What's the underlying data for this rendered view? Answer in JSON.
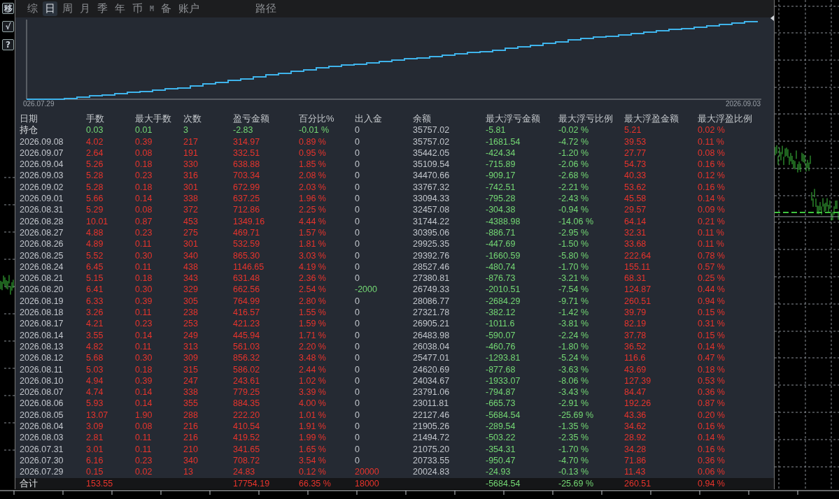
{
  "side_buttons": [
    "移",
    "√",
    "?"
  ],
  "tabs": [
    {
      "label": "综",
      "kind": "text",
      "selected": false
    },
    {
      "label": "日",
      "kind": "text",
      "selected": true
    },
    {
      "label": "周",
      "kind": "text",
      "selected": false
    },
    {
      "label": "月",
      "kind": "text",
      "selected": false
    },
    {
      "label": "季",
      "kind": "text",
      "selected": false
    },
    {
      "label": "年",
      "kind": "text",
      "selected": false
    },
    {
      "label": "币",
      "kind": "text",
      "selected": false
    },
    {
      "label": "M",
      "kind": "mono",
      "selected": false
    },
    {
      "label": "备",
      "kind": "text",
      "selected": false
    },
    {
      "label": "账户",
      "kind": "text",
      "selected": false
    }
  ],
  "path_button": "路径",
  "equity_chart": {
    "start_label": "026.07.29",
    "end_label": "2026.09.03"
  },
  "table": {
    "columns": [
      "日期",
      "手数",
      "最大手数",
      "次数",
      "盈亏金额",
      "百分比%",
      "出入金",
      "余额",
      "最大浮亏金额",
      "最大浮亏比例",
      "最大浮盈金额",
      "最大浮盈比例"
    ],
    "rows": [
      {
        "kind": "position",
        "color": "#74d874",
        "date": "持仓",
        "lots": "0.03",
        "max_lots": "0.01",
        "trades": "3",
        "pnl": "-2.83",
        "pct": "-0.01 %",
        "flow": {
          "text": "0",
          "color": "#c2c6cc"
        },
        "balance": "35757.02",
        "max_float_loss": "-5.81",
        "max_float_loss_pct": "-0.02 %",
        "max_float_profit": "5.21",
        "max_float_profit_pct": "0.02 %"
      },
      {
        "kind": "day",
        "color": "#e8342c",
        "date": "2026.09.08",
        "lots": "4.02",
        "max_lots": "0.39",
        "trades": "217",
        "pnl": "314.97",
        "pct": "0.89 %",
        "flow": {
          "text": "0",
          "color": "#c2c6cc"
        },
        "balance": "35757.02",
        "max_float_loss": "-1681.54",
        "max_float_loss_pct": "-4.72 %",
        "max_float_profit": "39.53",
        "max_float_profit_pct": "0.11 %"
      },
      {
        "kind": "day",
        "color": "#e8342c",
        "date": "2026.09.07",
        "lots": "2.64",
        "max_lots": "0.08",
        "trades": "191",
        "pnl": "332.51",
        "pct": "0.95 %",
        "flow": {
          "text": "0",
          "color": "#c2c6cc"
        },
        "balance": "35442.05",
        "max_float_loss": "-424.34",
        "max_float_loss_pct": "-1.20 %",
        "max_float_profit": "27.77",
        "max_float_profit_pct": "0.08 %"
      },
      {
        "kind": "day",
        "color": "#e8342c",
        "date": "2026.09.04",
        "lots": "5.26",
        "max_lots": "0.18",
        "trades": "330",
        "pnl": "638.88",
        "pct": "1.85 %",
        "flow": {
          "text": "0",
          "color": "#c2c6cc"
        },
        "balance": "35109.54",
        "max_float_loss": "-715.89",
        "max_float_loss_pct": "-2.06 %",
        "max_float_profit": "54.73",
        "max_float_profit_pct": "0.16 %"
      },
      {
        "kind": "day",
        "color": "#e8342c",
        "date": "2026.09.03",
        "lots": "5.28",
        "max_lots": "0.23",
        "trades": "316",
        "pnl": "703.34",
        "pct": "2.08 %",
        "flow": {
          "text": "0",
          "color": "#c2c6cc"
        },
        "balance": "34470.66",
        "max_float_loss": "-909.17",
        "max_float_loss_pct": "-2.68 %",
        "max_float_profit": "40.33",
        "max_float_profit_pct": "0.12 %"
      },
      {
        "kind": "day",
        "color": "#e8342c",
        "date": "2026.09.02",
        "lots": "5.28",
        "max_lots": "0.18",
        "trades": "301",
        "pnl": "672.99",
        "pct": "2.03 %",
        "flow": {
          "text": "0",
          "color": "#c2c6cc"
        },
        "balance": "33767.32",
        "max_float_loss": "-742.51",
        "max_float_loss_pct": "-2.21 %",
        "max_float_profit": "53.62",
        "max_float_profit_pct": "0.16 %"
      },
      {
        "kind": "day",
        "color": "#e8342c",
        "date": "2026.09.01",
        "lots": "5.66",
        "max_lots": "0.14",
        "trades": "338",
        "pnl": "637.25",
        "pct": "1.96 %",
        "flow": {
          "text": "0",
          "color": "#c2c6cc"
        },
        "balance": "33094.33",
        "max_float_loss": "-795.28",
        "max_float_loss_pct": "-2.43 %",
        "max_float_profit": "45.58",
        "max_float_profit_pct": "0.14 %"
      },
      {
        "kind": "day",
        "color": "#e8342c",
        "date": "2026.08.31",
        "lots": "5.29",
        "max_lots": "0.08",
        "trades": "372",
        "pnl": "712.86",
        "pct": "2.25 %",
        "flow": {
          "text": "0",
          "color": "#c2c6cc"
        },
        "balance": "32457.08",
        "max_float_loss": "-304.38",
        "max_float_loss_pct": "-0.94 %",
        "max_float_profit": "29.57",
        "max_float_profit_pct": "0.09 %"
      },
      {
        "kind": "day",
        "color": "#e8342c",
        "date": "2026.08.28",
        "lots": "10.01",
        "max_lots": "0.87",
        "trades": "453",
        "pnl": "1349.16",
        "pct": "4.44 %",
        "flow": {
          "text": "0",
          "color": "#c2c6cc"
        },
        "balance": "31744.22",
        "max_float_loss": "-4388.98",
        "max_float_loss_pct": "-14.06 %",
        "max_float_profit": "64.14",
        "max_float_profit_pct": "0.21 %"
      },
      {
        "kind": "day",
        "color": "#e8342c",
        "date": "2026.08.27",
        "lots": "4.88",
        "max_lots": "0.23",
        "trades": "275",
        "pnl": "469.71",
        "pct": "1.57 %",
        "flow": {
          "text": "0",
          "color": "#c2c6cc"
        },
        "balance": "30395.06",
        "max_float_loss": "-886.71",
        "max_float_loss_pct": "-2.95 %",
        "max_float_profit": "32.31",
        "max_float_profit_pct": "0.11 %"
      },
      {
        "kind": "day",
        "color": "#e8342c",
        "date": "2026.08.26",
        "lots": "4.89",
        "max_lots": "0.11",
        "trades": "301",
        "pnl": "532.59",
        "pct": "1.81 %",
        "flow": {
          "text": "0",
          "color": "#c2c6cc"
        },
        "balance": "29925.35",
        "max_float_loss": "-447.69",
        "max_float_loss_pct": "-1.50 %",
        "max_float_profit": "33.68",
        "max_float_profit_pct": "0.11 %"
      },
      {
        "kind": "day",
        "color": "#e8342c",
        "date": "2026.08.25",
        "lots": "5.52",
        "max_lots": "0.30",
        "trades": "340",
        "pnl": "865.30",
        "pct": "3.03 %",
        "flow": {
          "text": "0",
          "color": "#c2c6cc"
        },
        "balance": "29392.76",
        "max_float_loss": "-1660.59",
        "max_float_loss_pct": "-5.80 %",
        "max_float_profit": "222.64",
        "max_float_profit_pct": "0.78 %"
      },
      {
        "kind": "day",
        "color": "#e8342c",
        "date": "2026.08.24",
        "lots": "6.45",
        "max_lots": "0.11",
        "trades": "438",
        "pnl": "1146.65",
        "pct": "4.19 %",
        "flow": {
          "text": "0",
          "color": "#c2c6cc"
        },
        "balance": "28527.46",
        "max_float_loss": "-480.74",
        "max_float_loss_pct": "-1.70 %",
        "max_float_profit": "155.11",
        "max_float_profit_pct": "0.57 %"
      },
      {
        "kind": "day",
        "color": "#e8342c",
        "date": "2026.08.21",
        "lots": "5.15",
        "max_lots": "0.18",
        "trades": "343",
        "pnl": "631.48",
        "pct": "2.36 %",
        "flow": {
          "text": "0",
          "color": "#c2c6cc"
        },
        "balance": "27380.81",
        "max_float_loss": "-876.73",
        "max_float_loss_pct": "-3.21 %",
        "max_float_profit": "68.31",
        "max_float_profit_pct": "0.25 %"
      },
      {
        "kind": "day",
        "color": "#e8342c",
        "date": "2026.08.20",
        "lots": "6.41",
        "max_lots": "0.30",
        "trades": "329",
        "pnl": "662.56",
        "pct": "2.54 %",
        "flow": {
          "text": "-2000",
          "color": "#74d874"
        },
        "balance": "26749.33",
        "max_float_loss": "-2010.51",
        "max_float_loss_pct": "-7.54 %",
        "max_float_profit": "124.87",
        "max_float_profit_pct": "0.44 %"
      },
      {
        "kind": "day",
        "color": "#e8342c",
        "date": "2026.08.19",
        "lots": "6.33",
        "max_lots": "0.39",
        "trades": "305",
        "pnl": "764.99",
        "pct": "2.80 %",
        "flow": {
          "text": "0",
          "color": "#c2c6cc"
        },
        "balance": "28086.77",
        "max_float_loss": "-2684.29",
        "max_float_loss_pct": "-9.71 %",
        "max_float_profit": "260.51",
        "max_float_profit_pct": "0.94 %"
      },
      {
        "kind": "day",
        "color": "#e8342c",
        "date": "2026.08.18",
        "lots": "3.26",
        "max_lots": "0.11",
        "trades": "238",
        "pnl": "416.57",
        "pct": "1.55 %",
        "flow": {
          "text": "0",
          "color": "#c2c6cc"
        },
        "balance": "27321.78",
        "max_float_loss": "-382.12",
        "max_float_loss_pct": "-1.42 %",
        "max_float_profit": "39.79",
        "max_float_profit_pct": "0.15 %"
      },
      {
        "kind": "day",
        "color": "#e8342c",
        "date": "2026.08.17",
        "lots": "4.21",
        "max_lots": "0.23",
        "trades": "253",
        "pnl": "421.23",
        "pct": "1.59 %",
        "flow": {
          "text": "0",
          "color": "#c2c6cc"
        },
        "balance": "26905.21",
        "max_float_loss": "-1011.6",
        "max_float_loss_pct": "-3.81 %",
        "max_float_profit": "82.19",
        "max_float_profit_pct": "0.31 %"
      },
      {
        "kind": "day",
        "color": "#e8342c",
        "date": "2026.08.14",
        "lots": "3.55",
        "max_lots": "0.14",
        "trades": "249",
        "pnl": "445.94",
        "pct": "1.71 %",
        "flow": {
          "text": "0",
          "color": "#c2c6cc"
        },
        "balance": "26483.98",
        "max_float_loss": "-590.07",
        "max_float_loss_pct": "-2.24 %",
        "max_float_profit": "37.78",
        "max_float_profit_pct": "0.15 %"
      },
      {
        "kind": "day",
        "color": "#e8342c",
        "date": "2026.08.13",
        "lots": "4.82",
        "max_lots": "0.11",
        "trades": "313",
        "pnl": "561.03",
        "pct": "2.20 %",
        "flow": {
          "text": "0",
          "color": "#c2c6cc"
        },
        "balance": "26038.04",
        "max_float_loss": "-460.76",
        "max_float_loss_pct": "-1.80 %",
        "max_float_profit": "36.52",
        "max_float_profit_pct": "0.14 %"
      },
      {
        "kind": "day",
        "color": "#e8342c",
        "date": "2026.08.12",
        "lots": "5.68",
        "max_lots": "0.30",
        "trades": "309",
        "pnl": "856.32",
        "pct": "3.48 %",
        "flow": {
          "text": "0",
          "color": "#c2c6cc"
        },
        "balance": "25477.01",
        "max_float_loss": "-1293.81",
        "max_float_loss_pct": "-5.24 %",
        "max_float_profit": "116.6",
        "max_float_profit_pct": "0.47 %"
      },
      {
        "kind": "day",
        "color": "#e8342c",
        "date": "2026.08.11",
        "lots": "5.03",
        "max_lots": "0.18",
        "trades": "315",
        "pnl": "586.02",
        "pct": "2.44 %",
        "flow": {
          "text": "0",
          "color": "#c2c6cc"
        },
        "balance": "24620.69",
        "max_float_loss": "-877.68",
        "max_float_loss_pct": "-3.63 %",
        "max_float_profit": "43.69",
        "max_float_profit_pct": "0.18 %"
      },
      {
        "kind": "day",
        "color": "#e8342c",
        "date": "2026.08.10",
        "lots": "4.94",
        "max_lots": "0.39",
        "trades": "247",
        "pnl": "243.61",
        "pct": "1.02 %",
        "flow": {
          "text": "0",
          "color": "#c2c6cc"
        },
        "balance": "24034.67",
        "max_float_loss": "-1933.07",
        "max_float_loss_pct": "-8.06 %",
        "max_float_profit": "127.39",
        "max_float_profit_pct": "0.53 %"
      },
      {
        "kind": "day",
        "color": "#e8342c",
        "date": "2026.08.07",
        "lots": "4.74",
        "max_lots": "0.14",
        "trades": "338",
        "pnl": "779.25",
        "pct": "3.39 %",
        "flow": {
          "text": "0",
          "color": "#c2c6cc"
        },
        "balance": "23791.06",
        "max_float_loss": "-794.87",
        "max_float_loss_pct": "-3.43 %",
        "max_float_profit": "84.47",
        "max_float_profit_pct": "0.36 %"
      },
      {
        "kind": "day",
        "color": "#e8342c",
        "date": "2026.08.06",
        "lots": "5.93",
        "max_lots": "0.14",
        "trades": "355",
        "pnl": "884.35",
        "pct": "4.00 %",
        "flow": {
          "text": "0",
          "color": "#c2c6cc"
        },
        "balance": "23011.81",
        "max_float_loss": "-665.73",
        "max_float_loss_pct": "-2.91 %",
        "max_float_profit": "192.26",
        "max_float_profit_pct": "0.87 %"
      },
      {
        "kind": "day",
        "color": "#e8342c",
        "date": "2026.08.05",
        "lots": "13.07",
        "max_lots": "1.90",
        "trades": "288",
        "pnl": "222.20",
        "pct": "1.01 %",
        "flow": {
          "text": "0",
          "color": "#c2c6cc"
        },
        "balance": "22127.46",
        "max_float_loss": "-5684.54",
        "max_float_loss_pct": "-25.69 %",
        "max_float_profit": "43.36",
        "max_float_profit_pct": "0.20 %"
      },
      {
        "kind": "day",
        "color": "#e8342c",
        "date": "2026.08.04",
        "lots": "3.09",
        "max_lots": "0.08",
        "trades": "216",
        "pnl": "410.54",
        "pct": "1.91 %",
        "flow": {
          "text": "0",
          "color": "#c2c6cc"
        },
        "balance": "21905.26",
        "max_float_loss": "-289.54",
        "max_float_loss_pct": "-1.35 %",
        "max_float_profit": "34.62",
        "max_float_profit_pct": "0.16 %"
      },
      {
        "kind": "day",
        "color": "#e8342c",
        "date": "2026.08.03",
        "lots": "2.81",
        "max_lots": "0.11",
        "trades": "216",
        "pnl": "419.52",
        "pct": "1.99 %",
        "flow": {
          "text": "0",
          "color": "#c2c6cc"
        },
        "balance": "21494.72",
        "max_float_loss": "-503.22",
        "max_float_loss_pct": "-2.35 %",
        "max_float_profit": "28.92",
        "max_float_profit_pct": "0.14 %"
      },
      {
        "kind": "day",
        "color": "#e8342c",
        "date": "2026.07.31",
        "lots": "3.01",
        "max_lots": "0.11",
        "trades": "210",
        "pnl": "341.65",
        "pct": "1.65 %",
        "flow": {
          "text": "0",
          "color": "#c2c6cc"
        },
        "balance": "21075.20",
        "max_float_loss": "-354.31",
        "max_float_loss_pct": "-1.70 %",
        "max_float_profit": "34.28",
        "max_float_profit_pct": "0.16 %"
      },
      {
        "kind": "day",
        "color": "#e8342c",
        "date": "2026.07.30",
        "lots": "6.16",
        "max_lots": "0.23",
        "trades": "340",
        "pnl": "708.72",
        "pct": "3.54 %",
        "flow": {
          "text": "0",
          "color": "#c2c6cc"
        },
        "balance": "20733.55",
        "max_float_loss": "-950.47",
        "max_float_loss_pct": "-4.70 %",
        "max_float_profit": "71.86",
        "max_float_profit_pct": "0.36 %"
      },
      {
        "kind": "day",
        "color": "#e8342c",
        "date": "2026.07.29",
        "lots": "0.15",
        "max_lots": "0.02",
        "trades": "13",
        "pnl": "24.83",
        "pct": "0.12 %",
        "flow": {
          "text": "20000",
          "color": "#e8342c"
        },
        "balance": "20024.83",
        "max_float_loss": "-24.93",
        "max_float_loss_pct": "-0.13 %",
        "max_float_profit": "11.43",
        "max_float_profit_pct": "0.06 %"
      },
      {
        "kind": "total",
        "color": "#e8342c",
        "date": "合计",
        "lots": "153.55",
        "pnl": "17754.19",
        "pct": "66.35 %",
        "flow": {
          "text": "18000",
          "color": "#e8342c"
        },
        "max_float_loss": "-5684.54",
        "max_float_loss_pct": "-25.69 %",
        "max_float_profit": "260.51",
        "max_float_profit_pct": "0.94 %"
      }
    ]
  }
}
